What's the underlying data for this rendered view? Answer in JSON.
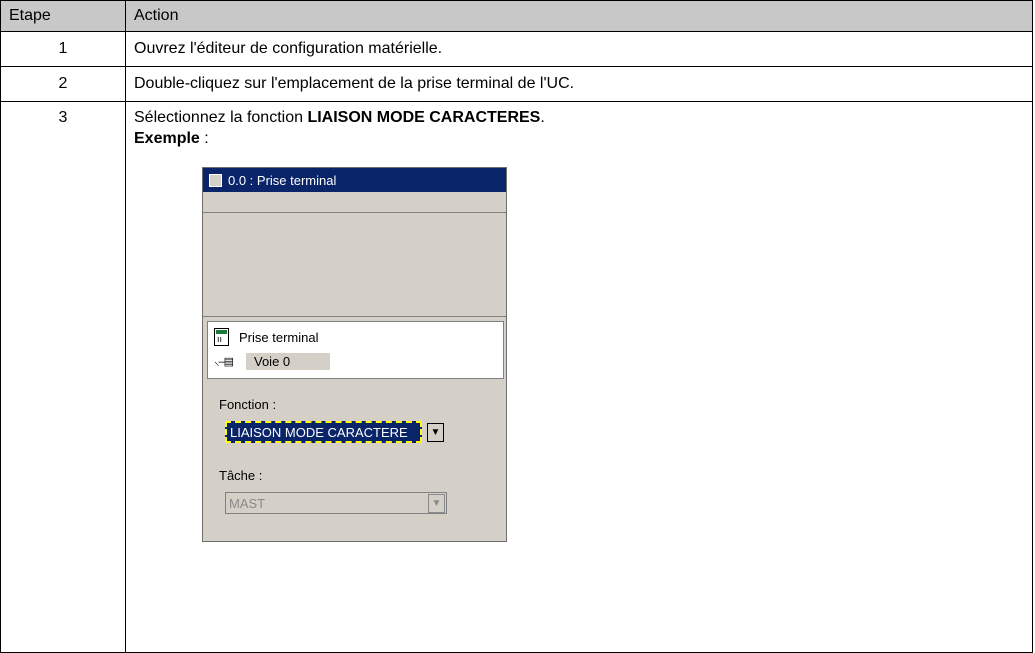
{
  "table": {
    "headers": [
      "Etape",
      "Action"
    ],
    "rows": [
      {
        "step": "1",
        "action": "Ouvrez l'éditeur de configuration matérielle."
      },
      {
        "step": "2",
        "action": "Double-cliquez sur l'emplacement de la prise terminal de l'UC."
      },
      {
        "step": "3",
        "action_prefix": "Sélectionnez la fonction ",
        "action_bold": "LIAISON MODE CARACTERES",
        "action_suffix": ".",
        "example_label": "Exemple",
        "example_suffix": " :"
      }
    ]
  },
  "dialog": {
    "title": "0.0 :  Prise terminal",
    "module_name": "Prise terminal",
    "channel": "Voie 0",
    "function_label": "Fonction :",
    "function_value": "LIAISON MODE CARACTERE",
    "task_label": "Tâche :",
    "task_value": "MAST",
    "icons": {
      "terminal": "terminal-icon",
      "channel": "channel-link-icon",
      "dropdown": "chevron-down-icon"
    }
  }
}
